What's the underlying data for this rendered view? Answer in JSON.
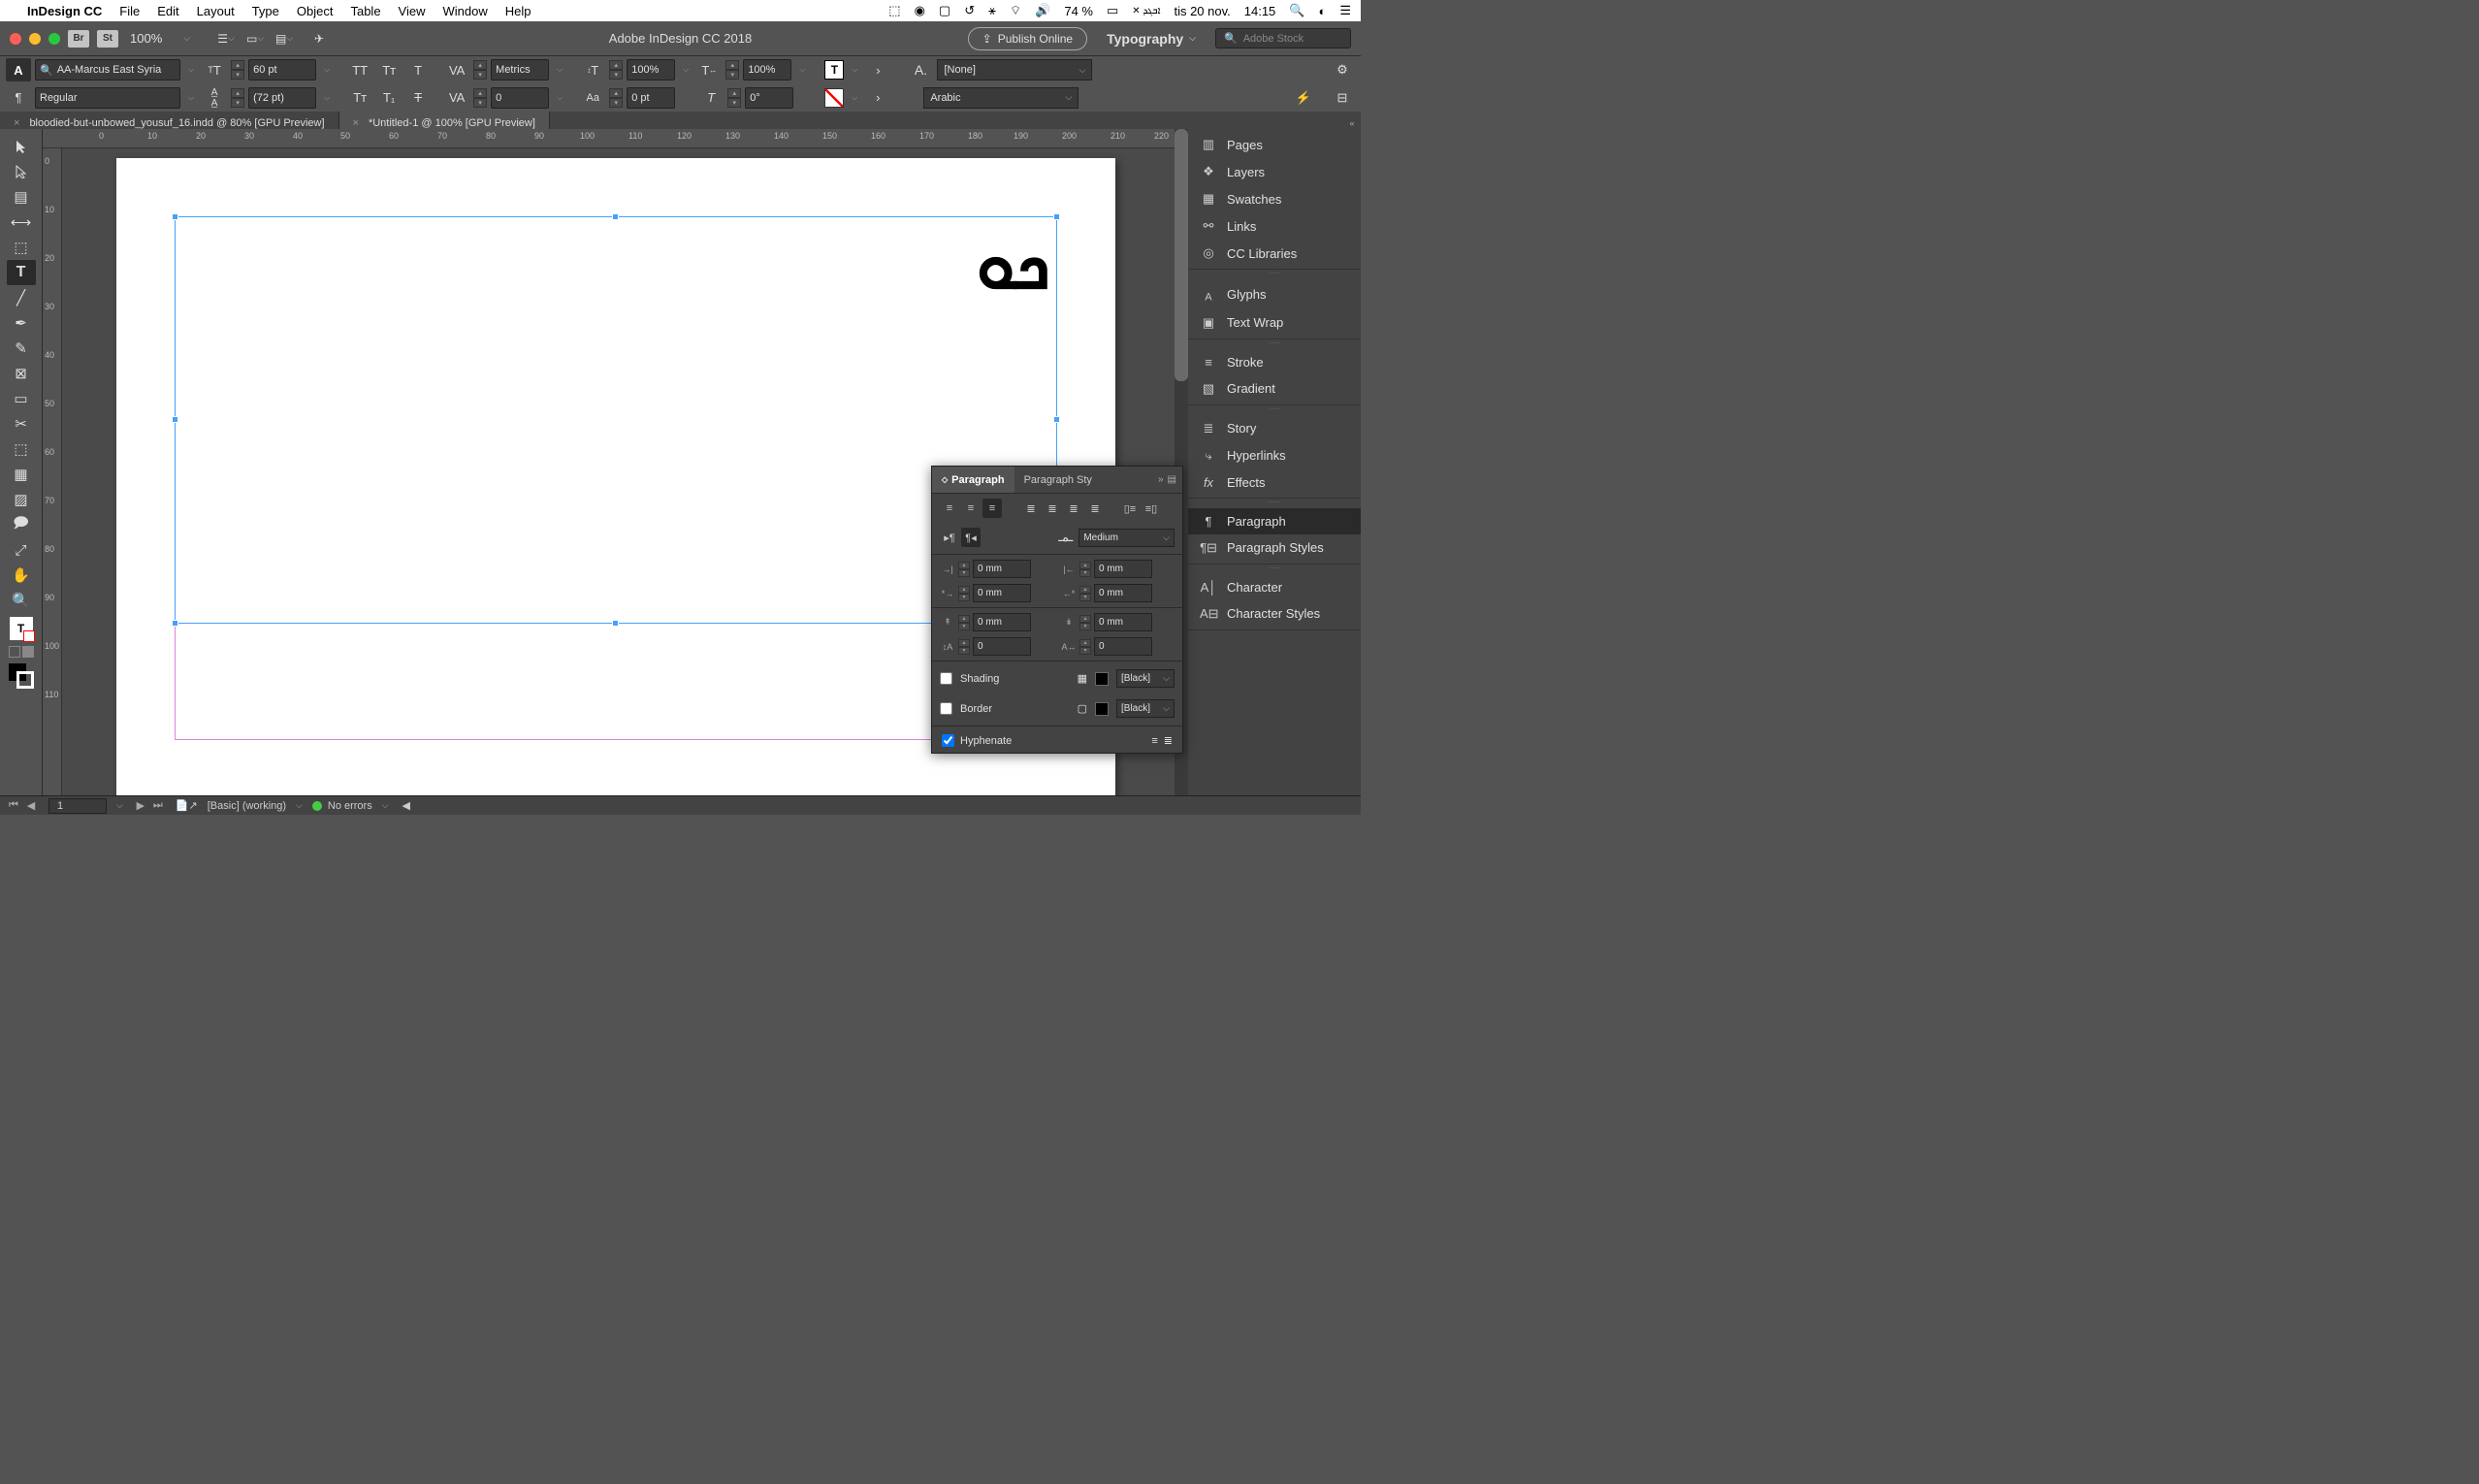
{
  "menubar": {
    "app_name": "InDesign CC",
    "menus": [
      "File",
      "Edit",
      "Layout",
      "Type",
      "Object",
      "Table",
      "View",
      "Window",
      "Help"
    ],
    "battery": "74 %",
    "date": "tis 20 nov.",
    "time": "14:15"
  },
  "titlerow": {
    "br": "Br",
    "st": "St",
    "zoom": "100%",
    "doc_title": "Adobe InDesign CC 2018",
    "publish": "Publish Online",
    "workspace": "Typography",
    "search_placeholder": "Adobe Stock"
  },
  "ctrl": {
    "A_icon": "A",
    "font": "AA-Marcus East Syria",
    "size_icon": "T",
    "size": "60 pt",
    "leading_icon": "A",
    "leading": "(72 pt)",
    "kerning_lbl": "VA",
    "kerning": "Metrics",
    "tracking_lbl": "VA",
    "tracking": "0",
    "vscale_lbl": "T",
    "vscale": "100%",
    "hscale_lbl": "T",
    "hscale": "100%",
    "baseline_lbl": "Aa",
    "baseline": "0 pt",
    "skew_lbl": "T",
    "skew": "0°",
    "fill_T": "T",
    "char_style_lbl": "A.",
    "char_style": "[None]",
    "P_icon": "¶",
    "style": "Regular",
    "lang": "Arabic"
  },
  "tabs": {
    "t1": "bloodied-but-unbowed_yousuf_16.indd @ 80% [GPU Preview]",
    "t2": "*Untitled-1 @ 100% [GPU Preview]"
  },
  "hruler": [
    "0",
    "10",
    "20",
    "30",
    "40",
    "50",
    "60",
    "70",
    "80",
    "90",
    "100",
    "110",
    "120",
    "130",
    "140",
    "150",
    "160",
    "170",
    "180",
    "190",
    "200",
    "210",
    "220"
  ],
  "vruler": [
    "0",
    "10",
    "20",
    "30",
    "40",
    "50",
    "60",
    "70",
    "80",
    "90",
    "100",
    "110"
  ],
  "arabic_text": "ܟܘ",
  "rightdock": {
    "g1": [
      "Pages",
      "Layers",
      "Swatches",
      "Links",
      "CC Libraries"
    ],
    "g2": [
      "Glyphs",
      "Text Wrap"
    ],
    "g3": [
      "Stroke",
      "Gradient"
    ],
    "g4": [
      "Story",
      "Hyperlinks",
      "Effects"
    ],
    "g5": [
      "Paragraph",
      "Paragraph Styles"
    ],
    "g6": [
      "Character",
      "Character Styles"
    ]
  },
  "para": {
    "tab1": "Paragraph",
    "tab2": "Paragraph Sty",
    "dir_select": "Medium",
    "left_indent": "0 mm",
    "right_indent": "0 mm",
    "first_indent": "0 mm",
    "last_indent": "0 mm",
    "space_before": "0 mm",
    "space_after": "0 mm",
    "drop_lines": "0",
    "drop_chars": "0",
    "shading_lbl": "Shading",
    "shading_val": "[Black]",
    "border_lbl": "Border",
    "border_val": "[Black]",
    "hyphenate": "Hyphenate"
  },
  "status": {
    "page": "1",
    "preflight": "[Basic] (working)",
    "errors": "No errors"
  }
}
